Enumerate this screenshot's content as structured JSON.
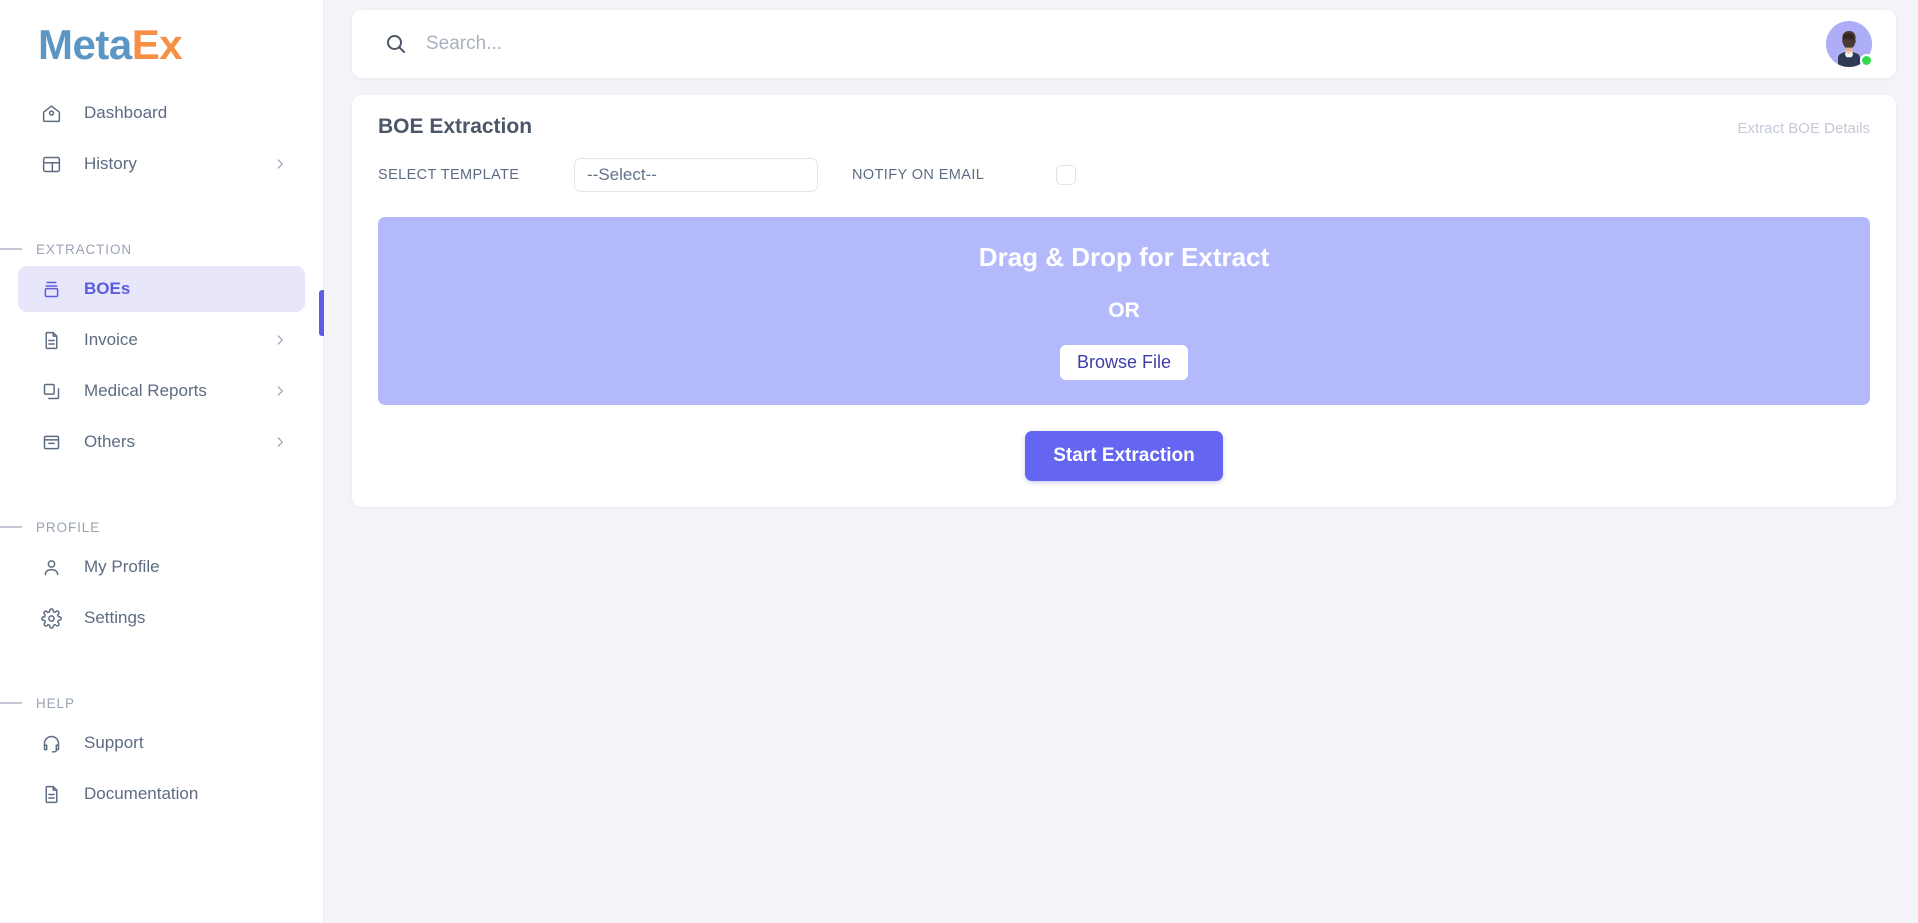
{
  "brand": {
    "part1": "Meta",
    "part2": "Ex",
    "color1": "#5b96c4",
    "color2": "#f79044"
  },
  "sidebar": {
    "top_items": [
      {
        "label": "Dashboard",
        "icon": "home-icon",
        "chevron": false,
        "active": false
      },
      {
        "label": "History",
        "icon": "layout-icon",
        "chevron": true,
        "active": false
      }
    ],
    "sections": [
      {
        "title": "EXTRACTION",
        "items": [
          {
            "label": "BOEs",
            "icon": "archive-box-icon",
            "chevron": false,
            "active": true
          },
          {
            "label": "Invoice",
            "icon": "document-text-icon",
            "chevron": true,
            "active": false
          },
          {
            "label": "Medical Reports",
            "icon": "copy-icon",
            "chevron": true,
            "active": false
          },
          {
            "label": "Others",
            "icon": "archive-icon",
            "chevron": true,
            "active": false
          }
        ]
      },
      {
        "title": "PROFILE",
        "items": [
          {
            "label": "My Profile",
            "icon": "user-icon",
            "chevron": false,
            "active": false
          },
          {
            "label": "Settings",
            "icon": "gear-icon",
            "chevron": false,
            "active": false
          }
        ]
      },
      {
        "title": "HELP",
        "items": [
          {
            "label": "Support",
            "icon": "headset-icon",
            "chevron": false,
            "active": false
          },
          {
            "label": "Documentation",
            "icon": "document-text-icon",
            "chevron": false,
            "active": false
          }
        ]
      }
    ],
    "active_accent": "#5e5ce6",
    "active_background": "#e7e6fb"
  },
  "topbar": {
    "search_placeholder": "Search...",
    "search_value": "",
    "avatar_status": "online",
    "status_color": "#35d94c"
  },
  "card": {
    "title": "BOE Extraction",
    "subtitle": "Extract BOE Details",
    "select_template_label": "SELECT TEMPLATE",
    "select_value": "--Select--",
    "notify_label": "NOTIFY ON EMAIL",
    "notify_checked": false,
    "dropzone": {
      "title": "Drag & Drop for Extract",
      "or": "OR",
      "browse_label": "Browse File",
      "background": "#b4b9fb"
    },
    "start_button_label": "Start Extraction",
    "start_button_color": "#6466f1"
  }
}
